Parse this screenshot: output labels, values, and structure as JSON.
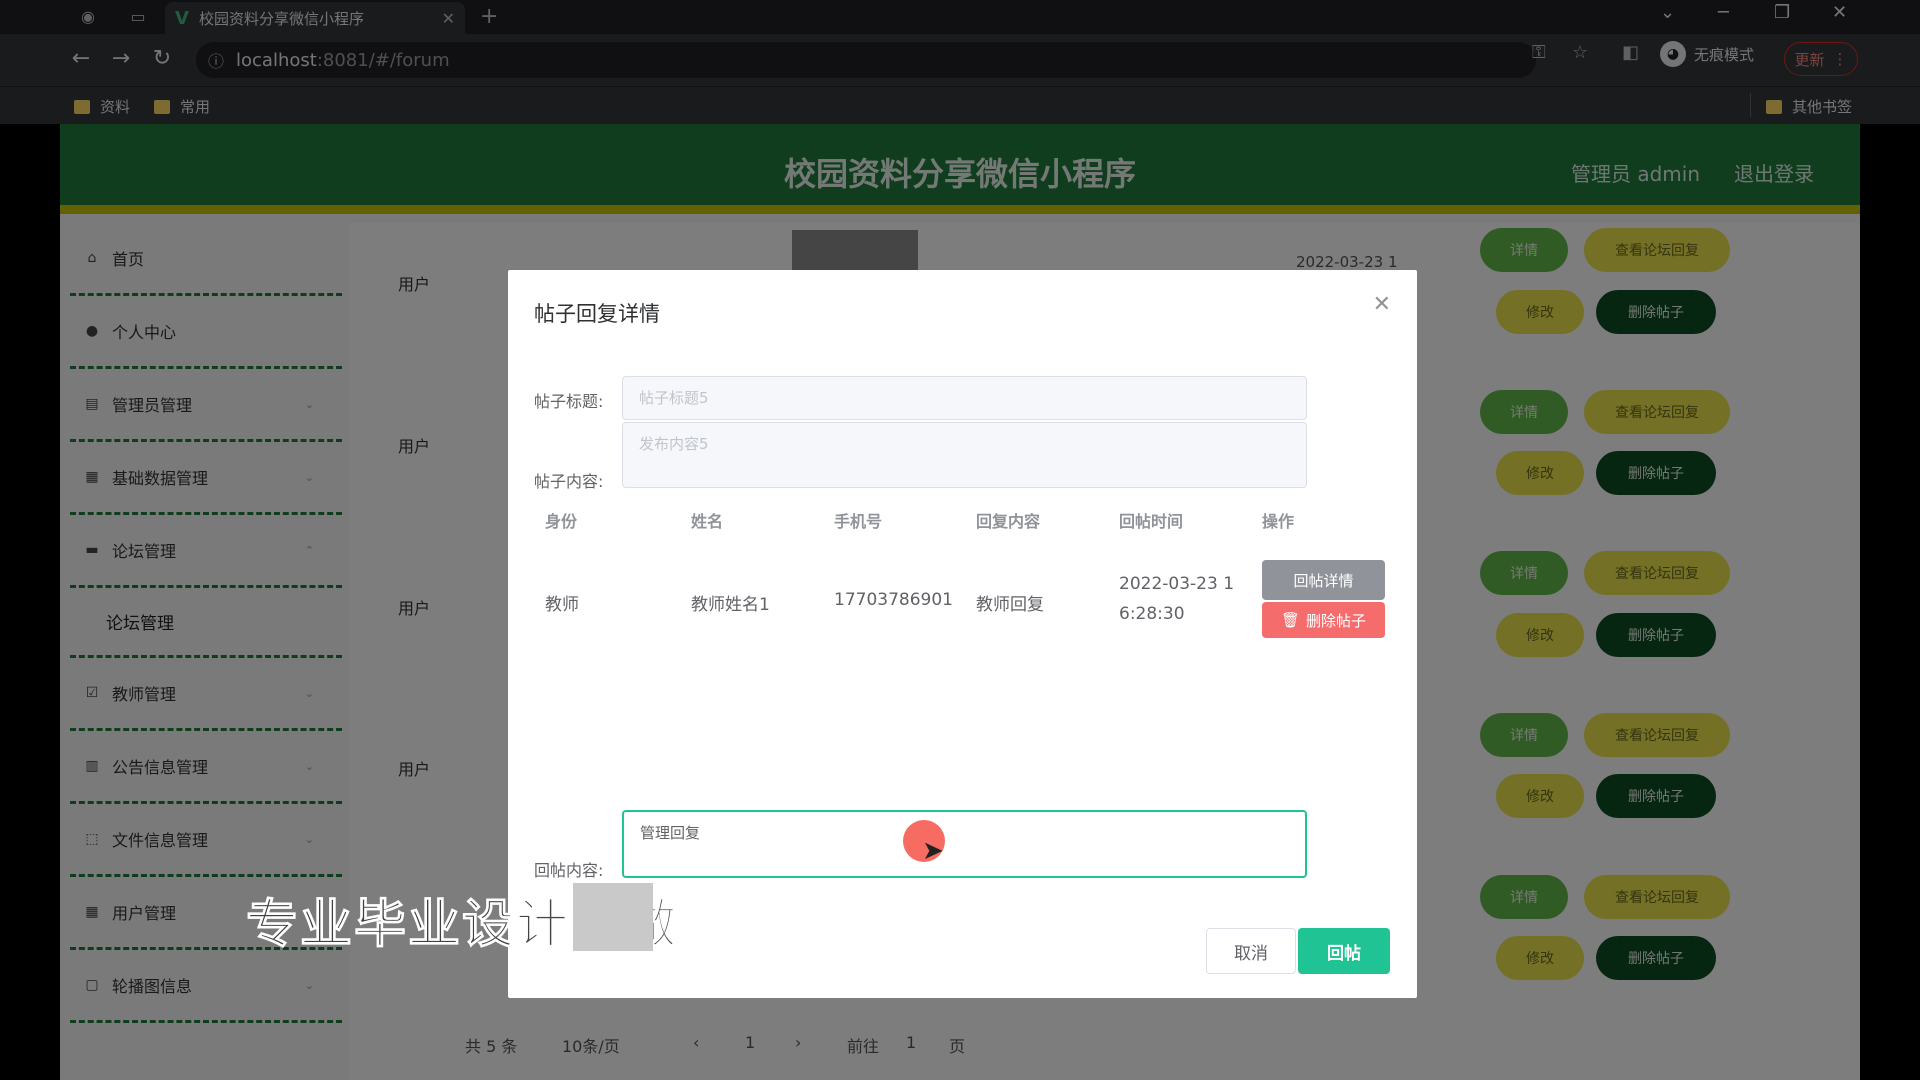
{
  "browser": {
    "tab_title": "校园资料分享微信小程序",
    "url_host": "localhost",
    "url_path": ":8081/#/forum",
    "incognito_label": "无痕模式",
    "update_label": "更新",
    "bookmarks": [
      "资料",
      "常用"
    ],
    "other_bookmarks": "其他书签"
  },
  "app": {
    "title": "校园资料分享微信小程序",
    "user_label": "管理员 admin",
    "logout_label": "退出登录"
  },
  "sidebar": {
    "items": [
      "首页",
      "个人中心",
      "管理员管理",
      "基础数据管理",
      "论坛管理",
      "教师管理",
      "公告信息管理",
      "文件信息管理",
      "用户管理",
      "轮播图信息"
    ],
    "sub_item": "论坛管理"
  },
  "content": {
    "row_role": "用户",
    "date_partial": "2022-03-23 1",
    "btn_detail": "详情",
    "btn_view_reply": "查看论坛回复",
    "btn_edit": "修改",
    "btn_delete_post": "删除帖子",
    "pager": {
      "total": "共 5 条",
      "page_size": "10条/页",
      "current": "1",
      "goto": "前往",
      "goto_page": "1",
      "page_unit": "页"
    }
  },
  "dialog": {
    "title": "帖子回复详情",
    "post_title_label": "帖子标题:",
    "post_title_placeholder": "帖子标题5",
    "post_content_label": "帖子内容:",
    "post_content_placeholder": "发布内容5",
    "columns": [
      "身份",
      "姓名",
      "手机号",
      "回复内容",
      "回帖时间",
      "操作"
    ],
    "row": {
      "role": "教师",
      "name": "教师姓名1",
      "phone": "17703786901",
      "reply": "教师回复",
      "time_line1": "2022-03-23 1",
      "time_line2": "6:28:30",
      "btn_detail": "回帖详情",
      "btn_delete": "删除帖子"
    },
    "reply_label": "回帖内容:",
    "reply_value": "管理回复",
    "cancel_label": "取消",
    "submit_label": "回帖"
  },
  "watermark": "专业毕业设计代做",
  "colors": {
    "header": "#1f7a3c",
    "accent": "#1fc394",
    "danger": "#f56c6c"
  }
}
